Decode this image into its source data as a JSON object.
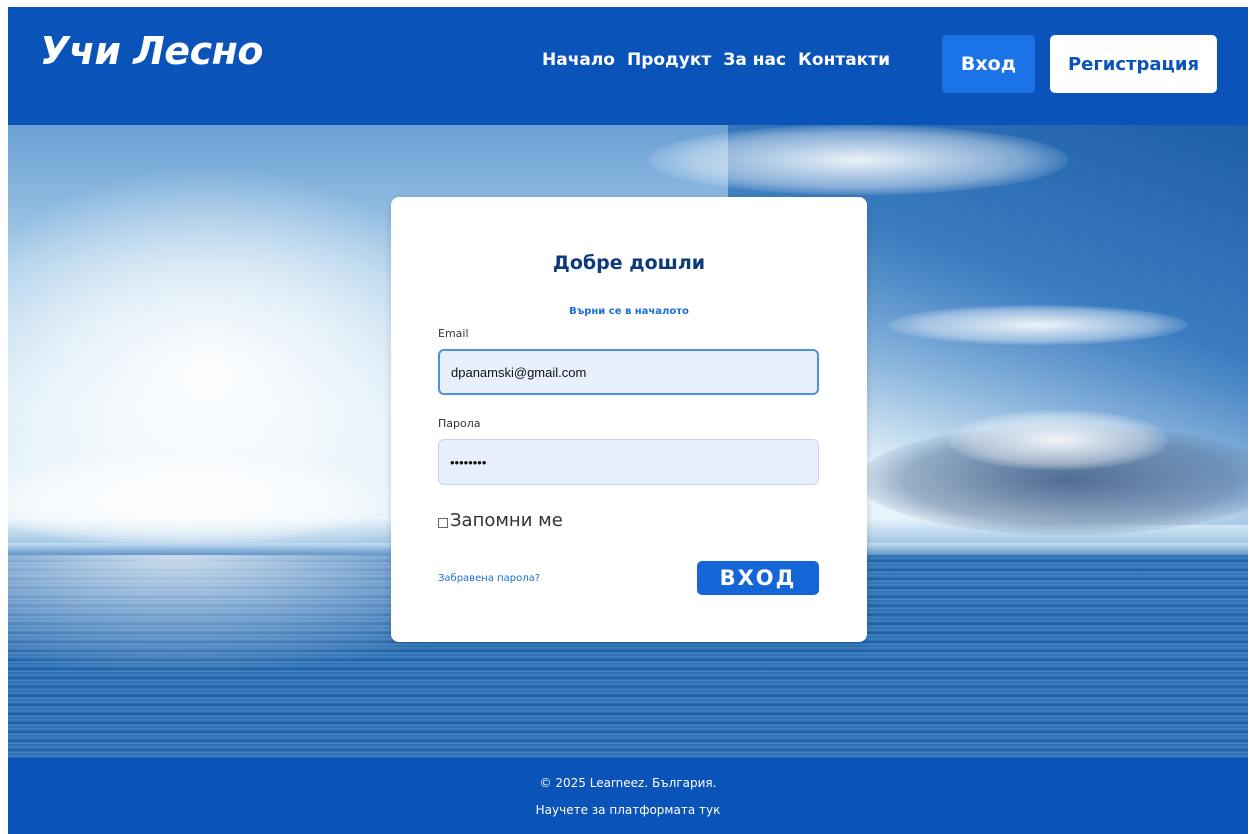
{
  "header": {
    "logo": "Учи Лесно",
    "nav": [
      "Начало",
      "Продукт",
      "За нас",
      "Контакти"
    ],
    "login_button": "Вход",
    "register_button": "Регистрация"
  },
  "login_form": {
    "title": "Добре дошли",
    "back_link": "Върни се в началото",
    "email_label": "Email",
    "email_value": "dpanamski@gmail.com",
    "password_label": "Парола",
    "password_value": "••••••••",
    "remember_label": "Запомни ме",
    "forgot_link": "Забравена парола?",
    "submit_button": "ВХОД"
  },
  "footer": {
    "copyright": "© 2025 Learneez. България.",
    "link": "Научете за платформата тук"
  },
  "colors": {
    "brand_blue": "#0a53b8",
    "accent_blue": "#1a74e8",
    "title_navy": "#0d3b7a"
  }
}
